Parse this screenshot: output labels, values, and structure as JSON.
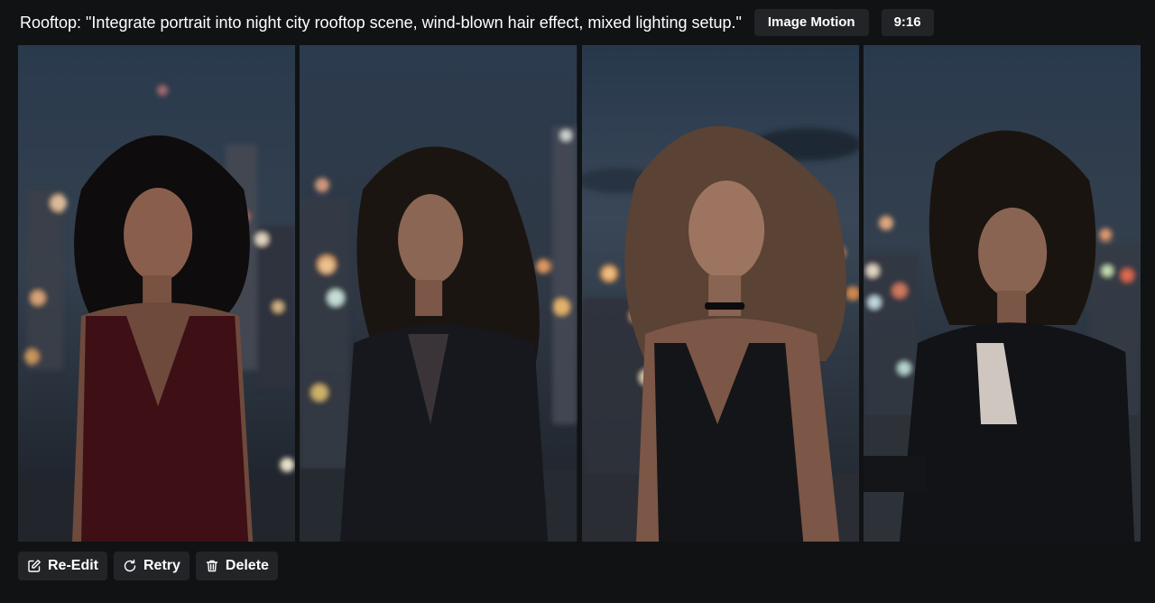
{
  "header": {
    "prompt_text": "Rooftop: \"Integrate portrait into night city rooftop scene, wind-blown hair effect, mixed lighting setup.\"",
    "mode_chip": "Image Motion",
    "ratio_chip": "9:16"
  },
  "gallery": {
    "images": [
      {
        "alt": "woman in red dress on rooftop at night",
        "outfit_color": "#3e0f15"
      },
      {
        "alt": "woman in black coat on rooftop at night",
        "outfit_color": "#16181d"
      },
      {
        "alt": "woman in black top with choker on rooftop at night",
        "outfit_color": "#141518"
      },
      {
        "alt": "woman in black blazer on rooftop at night",
        "outfit_color": "#121317"
      }
    ]
  },
  "actions": {
    "reedit_label": "Re-Edit",
    "retry_label": "Retry",
    "delete_label": "Delete"
  },
  "colors": {
    "background": "#111213",
    "chip_background": "#232427",
    "text": "#ffffff"
  }
}
